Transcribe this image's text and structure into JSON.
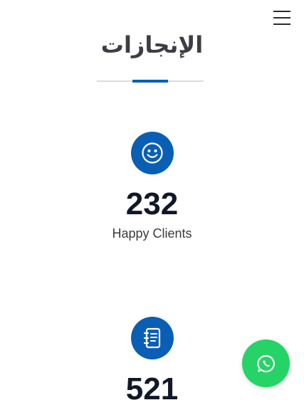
{
  "header": {
    "menu_icon": "hamburger-menu-icon"
  },
  "section": {
    "title": "الإنجازات"
  },
  "stats": [
    {
      "icon": "smiley-face-icon",
      "number": "232",
      "label": "Happy Clients"
    },
    {
      "icon": "notebook-icon",
      "number": "521",
      "label": ""
    }
  ],
  "floating": {
    "whatsapp_icon": "whatsapp-icon"
  },
  "colors": {
    "accent": "#0a5fb4",
    "whatsapp": "#25d366",
    "title": "#3d3d44",
    "number": "#111827"
  }
}
